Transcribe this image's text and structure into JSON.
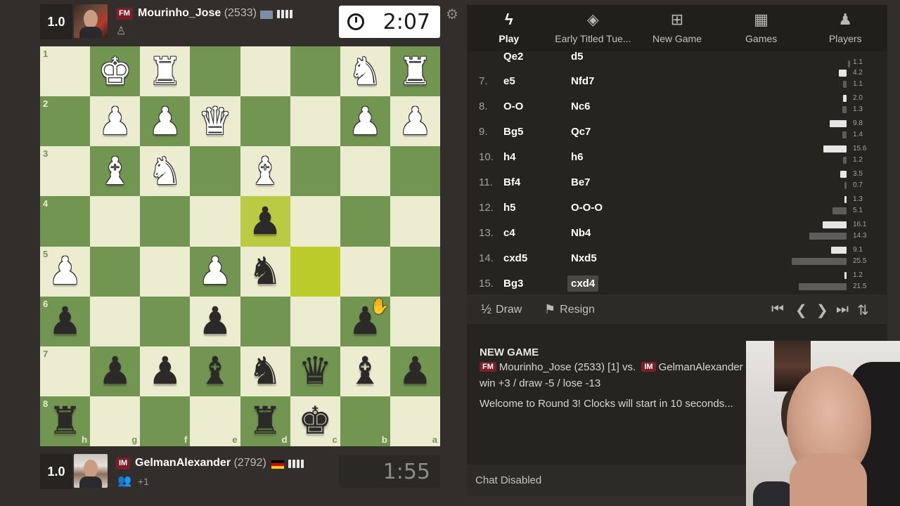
{
  "top_player": {
    "score": "1.0",
    "title": "FM",
    "name": "Mourinho_Jose",
    "rating": "(2533)",
    "clock": "2:07"
  },
  "bottom_player": {
    "score": "1.0",
    "title": "IM",
    "name": "GelmanAlexander",
    "rating": "(2792)",
    "clock": "1:55",
    "followers_extra": "+1"
  },
  "board": {
    "rank_labels": [
      "1",
      "2",
      "3",
      "4",
      "5",
      "6",
      "7",
      "8"
    ],
    "file_labels": [
      "h",
      "g",
      "f",
      "e",
      "d",
      "c",
      "b",
      "a"
    ],
    "pieces": [
      [
        "",
        "K",
        "R",
        "",
        "",
        "",
        "N",
        "R"
      ],
      [
        "",
        "P",
        "P",
        "Q",
        "",
        "",
        "P",
        "P"
      ],
      [
        "",
        "B",
        "N",
        "",
        "B",
        "",
        "",
        ""
      ],
      [
        "",
        "",
        "",
        "",
        "p",
        "",
        "",
        ""
      ],
      [
        "P",
        "",
        "",
        "P",
        "n",
        "",
        "",
        ""
      ],
      [
        "p",
        "",
        "",
        "p",
        "",
        "",
        "p",
        ""
      ],
      [
        "",
        "p",
        "p",
        "b",
        "n",
        "q",
        "b",
        "p"
      ],
      [
        "r",
        "",
        "",
        "",
        "r",
        "k",
        "",
        ""
      ]
    ],
    "highlights": {
      "last_from": "c5",
      "last_to": "d4"
    }
  },
  "tabs": [
    {
      "label": "Play",
      "icon": "lightning-icon",
      "glyph": "ϟ"
    },
    {
      "label": "Early Titled Tue...",
      "icon": "medal-icon",
      "glyph": "◈"
    },
    {
      "label": "New Game",
      "icon": "plus-square-icon",
      "glyph": "⊞"
    },
    {
      "label": "Games",
      "icon": "checkerboard-icon",
      "glyph": "▦"
    },
    {
      "label": "Players",
      "icon": "players-icon",
      "glyph": "♟"
    }
  ],
  "moves_partial": {
    "white": "Qe2",
    "black": "d5"
  },
  "moves": [
    {
      "num": "7.",
      "white": "e5",
      "black": "Nfd7",
      "tw": "4.2",
      "tb": "1.1",
      "tw_frac": 0.18,
      "tb_frac": 0.05
    },
    {
      "num": "8.",
      "white": "O-O",
      "black": "Nc6",
      "tw": "2.0",
      "tb": "1.3",
      "tw_frac": 0.09,
      "tb_frac": 0.06
    },
    {
      "num": "9.",
      "white": "Bg5",
      "black": "Qc7",
      "tw": "9.8",
      "tb": "1.4",
      "tw_frac": 0.4,
      "tb_frac": 0.06
    },
    {
      "num": "10.",
      "white": "h4",
      "black": "h6",
      "tw": "15.6",
      "tb": "1.2",
      "tw_frac": 0.55,
      "tb_frac": 0.05
    },
    {
      "num": "11.",
      "white": "Bf4",
      "black": "Be7",
      "tw": "3.5",
      "tb": "0.7",
      "tw_frac": 0.15,
      "tb_frac": 0.03
    },
    {
      "num": "12.",
      "white": "h5",
      "black": "O-O-O",
      "tw": "1.3",
      "tb": "5.1",
      "tw_frac": 0.05,
      "tb_frac": 0.2
    },
    {
      "num": "13.",
      "white": "c4",
      "black": "Nb4",
      "tw": "16.1",
      "tb": "14.3",
      "tw_frac": 0.57,
      "tb_frac": 0.53
    },
    {
      "num": "14.",
      "white": "cxd5",
      "black": "Nxd5",
      "tw": "9.1",
      "tb": "25.5",
      "tw_frac": 0.37,
      "tb_frac": 0.78
    },
    {
      "num": "15.",
      "white": "Bg3",
      "black": "cxd4",
      "tw": "1.2",
      "tb": "21.5",
      "tw_frac": 0.05,
      "tb_frac": 0.68
    }
  ],
  "partial_labels": {
    "tw": "",
    "tb": "1.1"
  },
  "controls": {
    "draw_label": "Draw",
    "draw_glyph": "½",
    "resign_label": "Resign"
  },
  "chat": {
    "heading": "NEW GAME",
    "line1_white_title": "FM",
    "line1_white": "Mourinho_Jose (2533) [1] vs.",
    "line1_black_title": "IM",
    "line1_black": "GelmanAlexander",
    "line2": "win +3 / draw -5 / lose -13",
    "line3": "Welcome to Round 3! Clocks will start in 10 seconds...",
    "disabled_label": "Chat Disabled"
  }
}
